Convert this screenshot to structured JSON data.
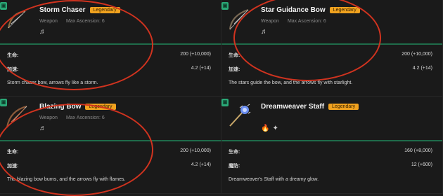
{
  "cards": [
    {
      "name": "Storm Chaser",
      "rarity": "Legendary",
      "type": "Weapon",
      "ascension": "Max Ascension: 6",
      "skills": [
        "♬"
      ],
      "stats": [
        {
          "label": "生命:",
          "value": "200 (+10,000)"
        },
        {
          "label": "加速:",
          "value": "4.2 (+14)"
        }
      ],
      "description": "Storm chaser bow, arrows fly like a storm.",
      "icon": "bow-icon",
      "gem": "▣"
    },
    {
      "name": "Star Guidance Bow",
      "rarity": "Legendary",
      "type": "Weapon",
      "ascension": "Max Ascension: 6",
      "skills": [
        "♬"
      ],
      "stats": [
        {
          "label": "生命:",
          "value": "200 (+10,000)"
        },
        {
          "label": "加速:",
          "value": "4.2 (+14)"
        }
      ],
      "description": "The stars guide the bow, and the arrows fly with starlight.",
      "icon": "bow-icon",
      "gem": "▣"
    },
    {
      "name": "Blazing Bow",
      "rarity": "Legendary",
      "type": "Weapon",
      "ascension": "Max Ascension: 6",
      "skills": [
        "♬"
      ],
      "stats": [
        {
          "label": "生命:",
          "value": "200 (+10,000)"
        },
        {
          "label": "加速:",
          "value": "4.2 (+14)"
        }
      ],
      "description": "The blazing bow burns, and the arrows fly with flames.",
      "icon": "bow-icon",
      "gem": "▣"
    },
    {
      "name": "Dreamweaver Staff",
      "rarity": "Legendary",
      "type": "",
      "ascension": "",
      "skills": [
        "🔥",
        "✦"
      ],
      "stats": [
        {
          "label": "生命:",
          "value": "160 (+8,000)"
        },
        {
          "label": "魔防:",
          "value": "12 (+600)"
        }
      ],
      "description": "Dreamweaver's Staff with a dreamy glow.",
      "icon": "staff-icon",
      "gem": "▣"
    }
  ],
  "colors": {
    "background": "#1c1c1c",
    "rarity_badge": "#f0a21f",
    "divider": "#1f6b4a",
    "annotation_circle": "#d0331f"
  }
}
